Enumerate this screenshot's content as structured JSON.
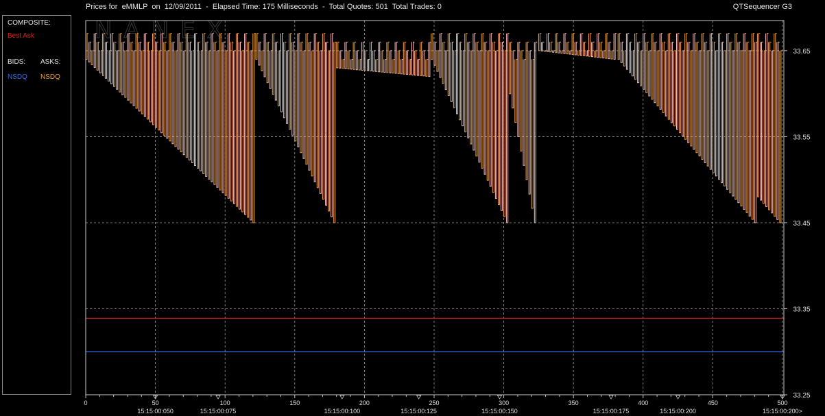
{
  "window": {
    "title": "Prices for  eMMLP  on  12/09/2011  -  Elapsed Time: 175 Milliseconds  -  Total Quotes: 501  Total Trades: 0",
    "app_name": "QTSequencer G3",
    "watermark": "NANEX"
  },
  "legend": {
    "composite_label": "COMPOSITE:",
    "best_ask_label": "Best Ask",
    "bids_label": "BIDS:",
    "asks_label": "ASKS:",
    "bid_exchange": "NSDQ",
    "ask_exchange": "NSDQ"
  },
  "colors": {
    "background": "#000000",
    "ask_line": "#f0a040",
    "ask_fill": "#f5b8b8",
    "best_ask": "#e02020",
    "bid_line": "#3a6ee8",
    "grid": "#c8c8c8",
    "axis": "#c8c8c8",
    "text": "#e0e0e0"
  },
  "chart_data": {
    "type": "line",
    "title": "",
    "xlabel": "",
    "ylabel": "",
    "xlim": [
      0,
      501
    ],
    "ylim": [
      33.25,
      33.685
    ],
    "grid": true,
    "legend_placement": "left-panel",
    "y_ticks": [
      "33.65",
      "33.55",
      "33.45",
      "33.35",
      "33.25"
    ],
    "x_ticks": [
      0,
      50,
      100,
      150,
      200,
      250,
      300,
      350,
      400,
      450,
      500
    ],
    "time_labels": [
      {
        "x": 50,
        "label": "15:15:00:050"
      },
      {
        "x": 95,
        "label": "15:15:00:075"
      },
      {
        "x": 184,
        "label": "15:15:00:100"
      },
      {
        "x": 239,
        "label": "15:15:00:125"
      },
      {
        "x": 297,
        "label": "15:15:00:150"
      },
      {
        "x": 377,
        "label": "15:15:00:175"
      },
      {
        "x": 425,
        "label": "15:15:00:200"
      },
      {
        "x": 500,
        "label": "15:15:00:200>"
      }
    ],
    "series": [
      {
        "name": "NSDQ",
        "role": "ask",
        "segments": [
          {
            "x_start": 0,
            "x_end": 122,
            "high": 33.67,
            "low": 33.45,
            "start_low": 33.64,
            "period": 2
          },
          {
            "x_start": 122,
            "x_end": 180,
            "high": 33.67,
            "low": 33.45,
            "start_low": 33.64,
            "period": 2
          },
          {
            "x_start": 180,
            "x_end": 248,
            "high": 33.66,
            "low": 33.62,
            "start_low": 33.63,
            "period": 2
          },
          {
            "x_start": 248,
            "x_end": 304,
            "high": 33.67,
            "low": 33.45,
            "start_low": 33.64,
            "period": 2
          },
          {
            "x_start": 304,
            "x_end": 325,
            "high": 33.66,
            "low": 33.45,
            "start_low": 33.6,
            "period": 2
          },
          {
            "x_start": 325,
            "x_end": 382,
            "high": 33.67,
            "low": 33.64,
            "start_low": 33.65,
            "period": 2
          },
          {
            "x_start": 382,
            "x_end": 482,
            "high": 33.67,
            "low": 33.45,
            "start_low": 33.64,
            "period": 2
          },
          {
            "x_start": 482,
            "x_end": 501,
            "high": 33.67,
            "low": 33.45,
            "start_low": 33.48,
            "period": 2
          }
        ]
      },
      {
        "name": "Best Ask",
        "role": "composite",
        "value": 33.339
      },
      {
        "name": "NSDQ",
        "role": "bid",
        "value": 33.3
      }
    ]
  }
}
